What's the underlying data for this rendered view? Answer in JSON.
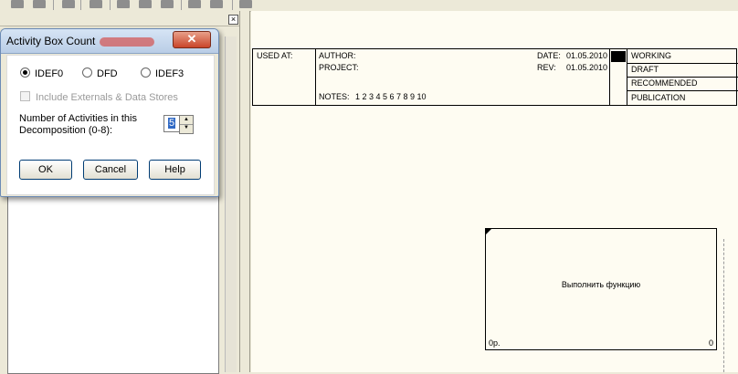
{
  "dialog": {
    "title": "Activity Box Count",
    "close_glyph": "✕",
    "radios": [
      {
        "label": "IDEF0",
        "checked": true
      },
      {
        "label": "DFD",
        "checked": false
      },
      {
        "label": "IDEF3",
        "checked": false
      }
    ],
    "checkbox_label": "Include Externals & Data Stores",
    "num_label_line1": "Number of Activities in this",
    "num_label_line2": "Decomposition (0-8):",
    "num_value": "5",
    "buttons": {
      "ok": "OK",
      "cancel": "Cancel",
      "help": "Help"
    }
  },
  "panel": {
    "close_glyph": "×"
  },
  "frame": {
    "used_at": "USED AT:",
    "author": "AUTHOR:",
    "project": "PROJECT:",
    "notes_label": "NOTES:",
    "notes_numbers": "1  2  3  4  5  6  7  8  9  10",
    "date_label": "DATE:",
    "date_value": "01.05.2010",
    "rev_label": "REV:",
    "rev_value": "01.05.2010",
    "status": [
      "WORKING",
      "DRAFT",
      "RECOMMENDED",
      "PUBLICATION"
    ]
  },
  "activity_box": {
    "label": "Выполнить функцию",
    "node": "0р.",
    "number": "0"
  }
}
